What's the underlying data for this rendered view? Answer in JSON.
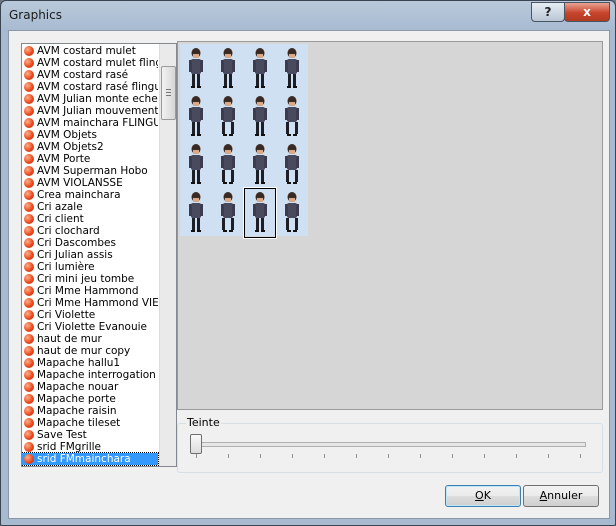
{
  "window": {
    "title": "Graphics",
    "help_label": "?",
    "close_label": "x"
  },
  "list": {
    "items": [
      "AVM costard mulet",
      "AVM costard mulet flingue",
      "AVM costard rasé",
      "AVM costard rasé flingue",
      "AVM Julian monte echelle",
      "AVM Julian mouvement",
      "AVM mainchara FLINGUE",
      "AVM Objets",
      "AVM Objets2",
      "AVM Porte",
      "AVM Superman Hobo",
      "AVM VIOLANSSE",
      "Crea mainchara",
      "Cri azale",
      "Cri client",
      "Cri clochard",
      "Cri Dascombes",
      "Cri Julian assis",
      "Cri lumière",
      "Cri mini jeu tombe",
      "Cri Mme Hammond",
      "Cri Mme Hammond VIEUX",
      "Cri Violette",
      "Cri Violette Evanouie",
      "haut de mur",
      "haut de mur copy",
      "Mapache hallu1",
      "Mapache interrogation",
      "Mapache nouar",
      "Mapache porte",
      "Mapache raisin",
      "Mapache tileset",
      "Save Test",
      "srid FMgrille",
      "srid FMmainchara"
    ],
    "selected_index": 34
  },
  "hue": {
    "label": "Teinte",
    "value": 0
  },
  "buttons": {
    "ok_prefix": "O",
    "ok_rest": "K",
    "cancel_prefix": "A",
    "cancel_rest": "nnuler"
  },
  "colors": {
    "selection": "#3399ff",
    "sprite_bg": "#cfe0f3",
    "close_button": "#c8452c"
  }
}
